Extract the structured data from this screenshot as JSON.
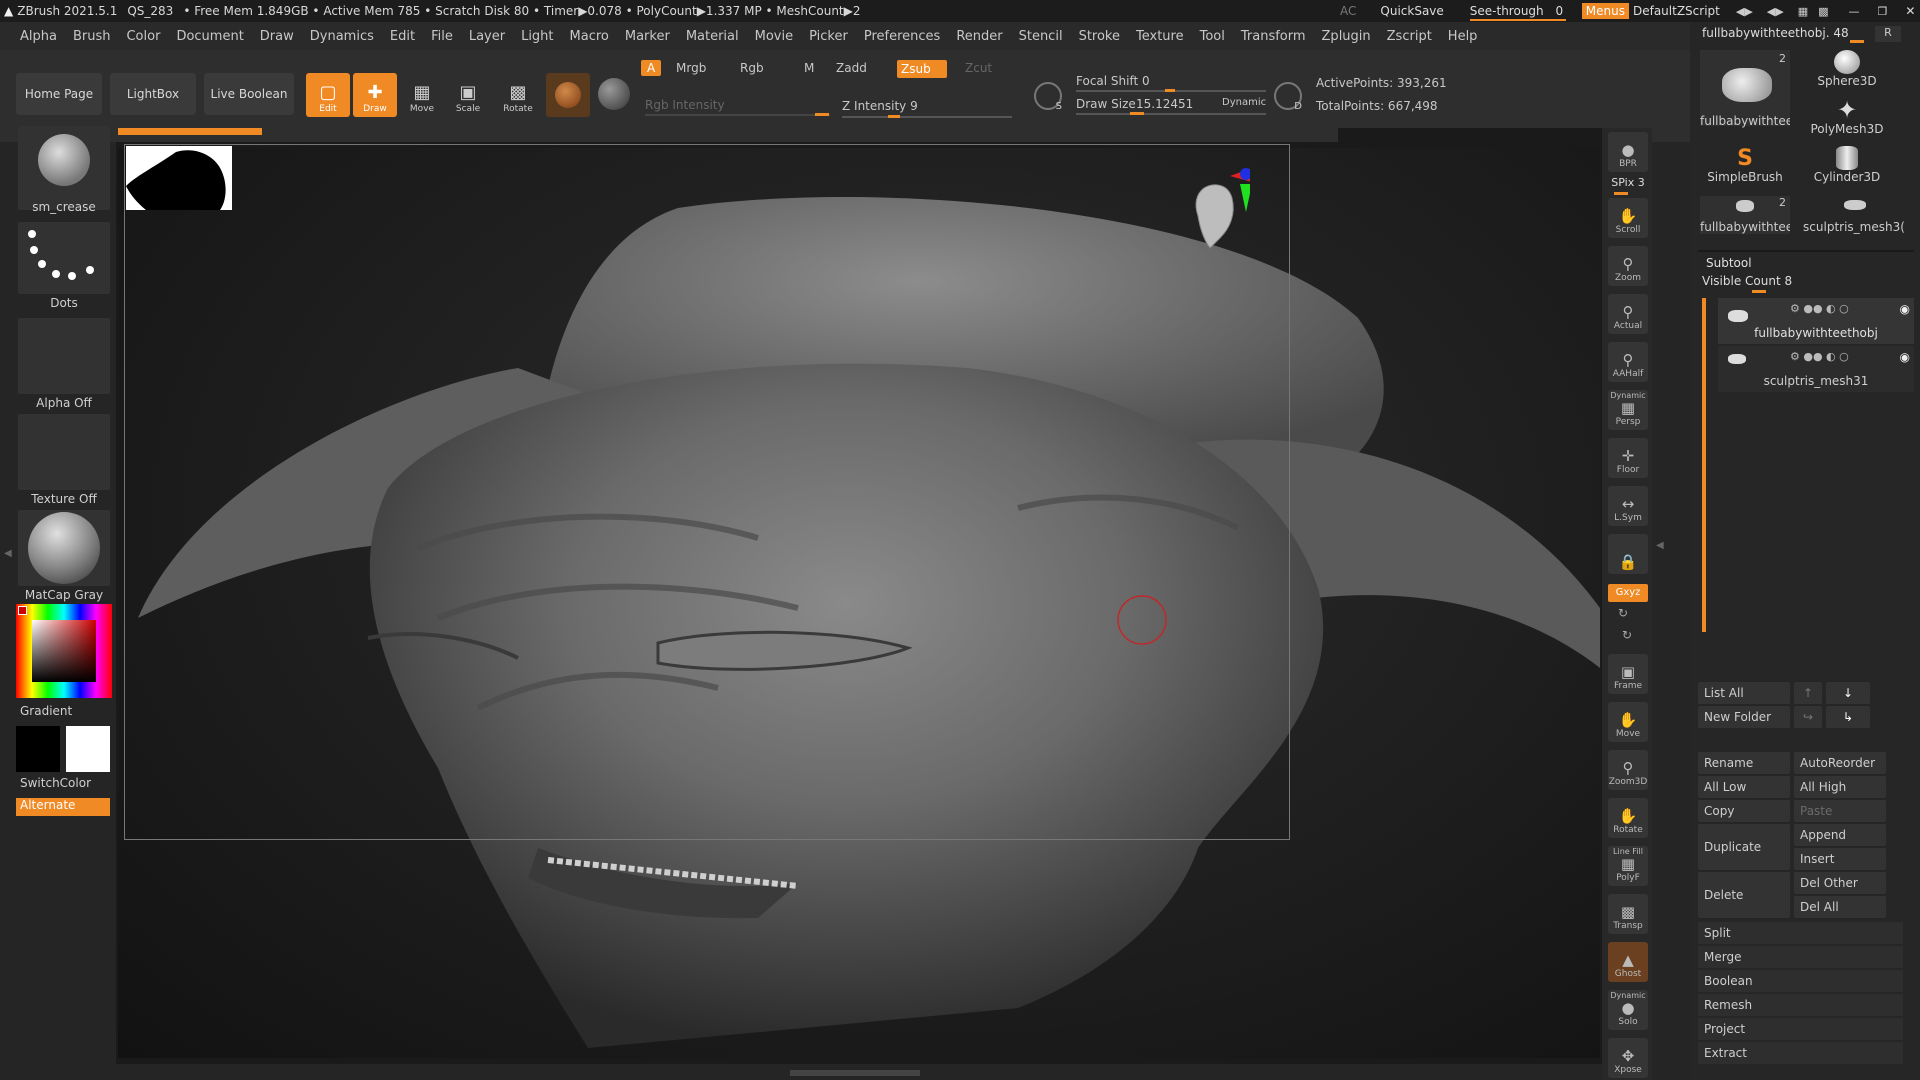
{
  "titlebar": {
    "app": "ZBrush 2021.5.1",
    "doc": "QS_283",
    "stats": "• Free Mem 1.849GB • Active Mem 785 • Scratch Disk 80 • Timer▶0.078 • PolyCount▶1.337 MP • MeshCount▶2",
    "ac": "AC",
    "quicksave": "QuickSave",
    "seethrough": "See-through",
    "seethrough_val": "0",
    "menus": "Menus",
    "script": "DefaultZScript"
  },
  "menu": [
    "Alpha",
    "Brush",
    "Color",
    "Document",
    "Draw",
    "Dynamics",
    "Edit",
    "File",
    "Layer",
    "Light",
    "Macro",
    "Marker",
    "Material",
    "Movie",
    "Picker",
    "Preferences",
    "Render",
    "Stencil",
    "Stroke",
    "Texture",
    "Tool",
    "Transform",
    "Zplugin",
    "Zscript",
    "Help"
  ],
  "shelf": {
    "home": "Home Page",
    "lightbox": "LightBox",
    "liveboolean": "Live Boolean",
    "edit": "Edit",
    "draw": "Draw",
    "move": "Move",
    "scale": "Scale",
    "rotate": "Rotate",
    "a": "A",
    "mrgb": "Mrgb",
    "rgb": "Rgb",
    "m": "M",
    "zadd": "Zadd",
    "zsub": "Zsub",
    "zcut": "Zcut",
    "rgb_intensity": "Rgb Intensity",
    "z_intensity": "Z Intensity 9",
    "focal_shift": "Focal Shift 0",
    "draw_size": "Draw Size",
    "draw_size_val": "15.12451",
    "dynamic": "Dynamic",
    "active_points": "ActivePoints: 393,261",
    "total_points": "TotalPoints: 667,498",
    "s": "S",
    "d": "D"
  },
  "left": {
    "brush": "sm_crease",
    "stroke": "Dots",
    "alpha": "Alpha Off",
    "texture": "Texture Off",
    "material": "MatCap Gray",
    "gradient": "Gradient",
    "switchcolor": "SwitchColor",
    "alternate": "Alternate"
  },
  "righttools": [
    "BPR",
    "SPix 3",
    "Scroll",
    "Zoom",
    "Actual",
    "AAHalf",
    "Persp",
    "Floor",
    "L.Sym",
    "Frame",
    "Move",
    "Zoom3D",
    "Rotate",
    "PolyF",
    "Transp",
    "Ghost",
    "Solo",
    "Xpose"
  ],
  "righttools_extra": {
    "dynamic": "Dynamic",
    "linefill": "Line Fill",
    "xyz": "Gxyz"
  },
  "tool": {
    "current": "fullbabywithteethobj. 48",
    "r": "R",
    "thumbs": [
      {
        "label": "fullbabywithteetl",
        "count": "2"
      },
      {
        "label": "Sphere3D",
        "count": ""
      },
      {
        "label": "PolyMesh3D",
        "count": ""
      },
      {
        "label": "SimpleBrush",
        "count": ""
      },
      {
        "label": "Cylinder3D",
        "count": ""
      },
      {
        "label": "fullbabywithteetl",
        "count": "2"
      },
      {
        "label": "sculptris_mesh3(",
        "count": ""
      }
    ]
  },
  "subtool": {
    "title": "Subtool",
    "visible_count": "Visible Count 8",
    "items": [
      "fullbabywithteethobj",
      "sculptris_mesh31"
    ],
    "list_all": "List All",
    "new_folder": "New Folder",
    "rename": "Rename",
    "autoreorder": "AutoReorder",
    "all_low": "All Low",
    "all_high": "All High",
    "copy": "Copy",
    "paste": "Paste",
    "duplicate": "Duplicate",
    "append": "Append",
    "insert": "Insert",
    "delete": "Delete",
    "del_other": "Del Other",
    "del_all": "Del All",
    "sections": [
      "Split",
      "Merge",
      "Boolean",
      "Remesh",
      "Project",
      "Extract"
    ]
  },
  "colors": {
    "accent": "#f08a24",
    "panel": "#262626",
    "bg": "#1a1a1a"
  }
}
